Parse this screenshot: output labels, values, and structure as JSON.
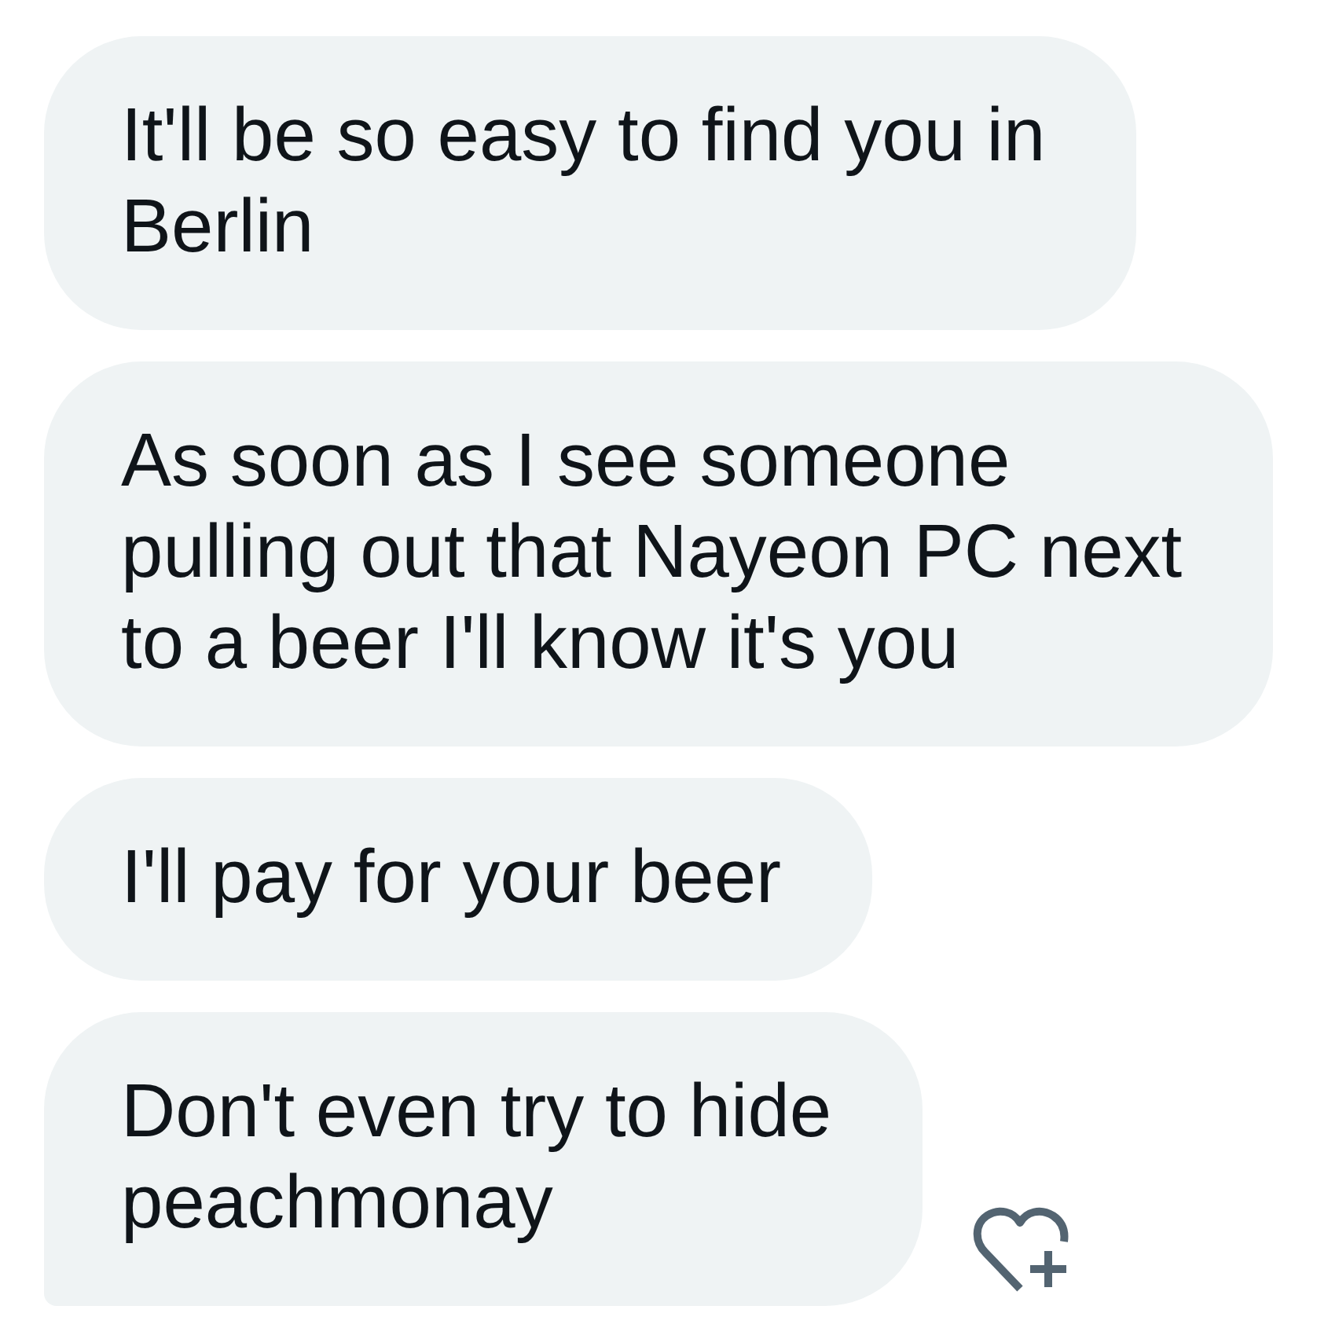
{
  "messages": [
    {
      "text": "It'll be so easy to find you in Berlin"
    },
    {
      "text": "As soon as I see someone pulling out that Nayeon PC next to a beer I'll know it's you"
    },
    {
      "text": "I'll pay for your beer"
    },
    {
      "text": "Don't even try to hide peachmonay"
    }
  ]
}
